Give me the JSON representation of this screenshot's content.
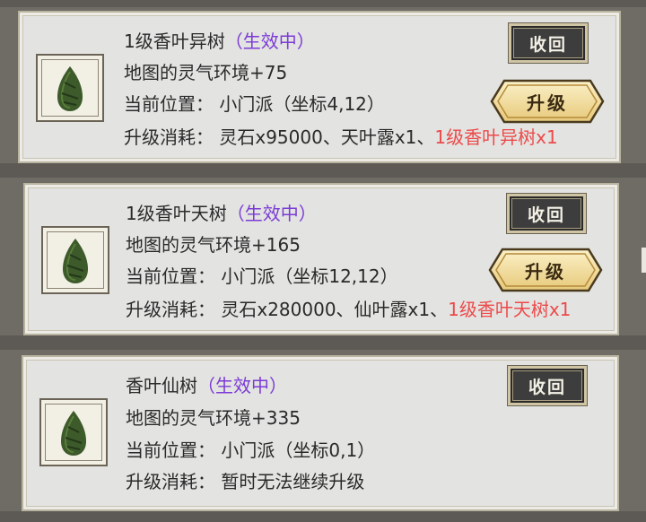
{
  "cards": [
    {
      "name": "1级香叶异树",
      "status": "（生效中）",
      "effect": "地图的灵气环境+75",
      "position": "当前位置：  小门派（坐标4,12）",
      "cost_prefix": "升级消耗：  灵石x95000、天叶露x1、",
      "cost_highlight": "1级香叶异树x1",
      "recall_label": "收回",
      "upgrade_label": "升级"
    },
    {
      "name": "1级香叶天树",
      "status": "（生效中）",
      "effect": "地图的灵气环境+165",
      "position": "当前位置：  小门派（坐标12,12）",
      "cost_prefix": "升级消耗：  灵石x280000、仙叶露x1、",
      "cost_highlight": "1级香叶天树x1",
      "recall_label": "收回",
      "upgrade_label": "升级"
    },
    {
      "name": "香叶仙树",
      "status": "（生效中）",
      "effect": "地图的灵气环境+335",
      "position": "当前位置：  小门派（坐标0,1）",
      "cost_prefix": "升级消耗：  暂时无法继续升级",
      "recall_label": "收回"
    }
  ],
  "colors": {
    "status": "#7b3bd6",
    "highlight": "#ec4a4a",
    "card_bg": "#e3e3e1",
    "tree": "#3c5a2a"
  },
  "icons": {
    "tree": "tree-icon"
  }
}
